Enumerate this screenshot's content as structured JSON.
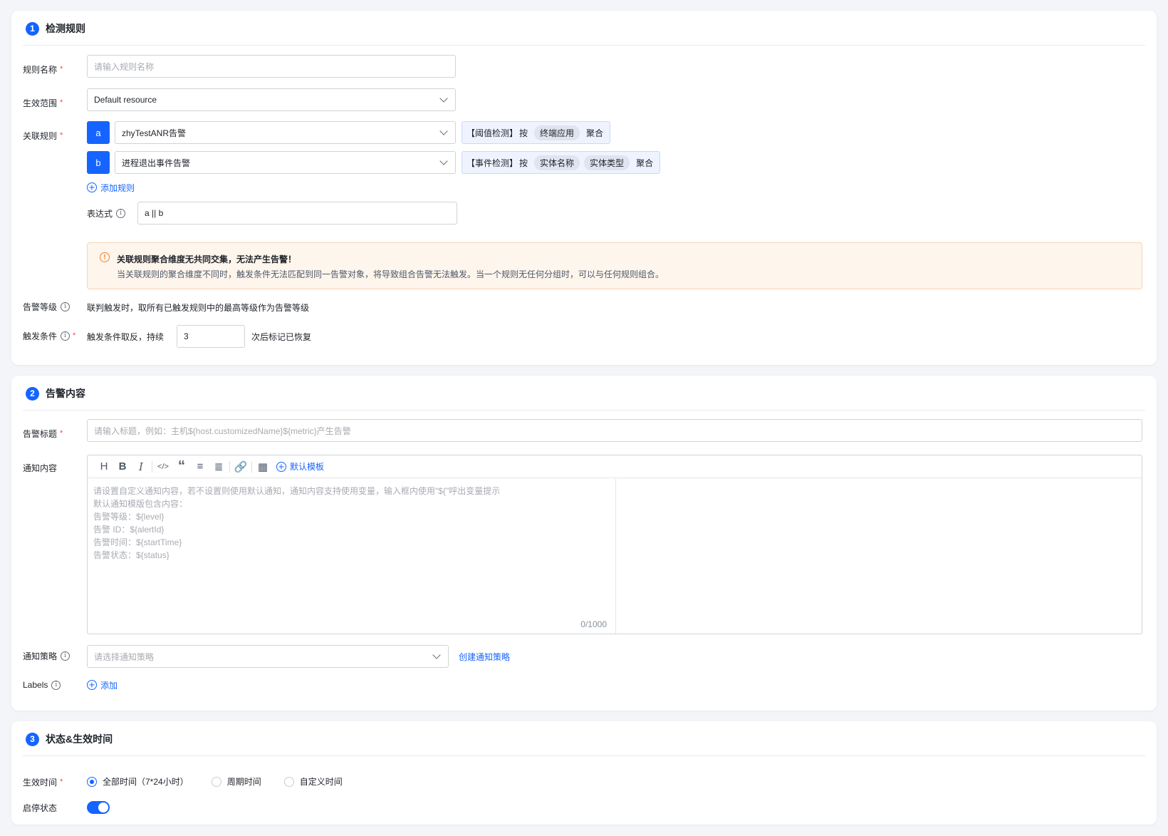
{
  "section1": {
    "num": "1",
    "title": "检测规则",
    "rule_name": {
      "label": "规则名称",
      "placeholder": "请输入规则名称"
    },
    "scope": {
      "label": "生效范围",
      "value": "Default resource"
    },
    "related": {
      "label": "关联规则",
      "rules": [
        {
          "badge": "a",
          "value": "zhyTestANR告警",
          "detect": "【阈值检测】",
          "by": "按",
          "tags": [
            "终端应用"
          ],
          "agg": "聚合"
        },
        {
          "badge": "b",
          "value": "进程退出事件告警",
          "detect": "【事件检测】",
          "by": "按",
          "tags": [
            "实体名称",
            "实体类型"
          ],
          "agg": "聚合"
        }
      ],
      "add_label": "添加规则"
    },
    "expression": {
      "label": "表达式",
      "value": "a || b"
    },
    "warning": {
      "title": "关联规则聚合维度无共同交集，无法产生告警！",
      "text": "当关联规则的聚合维度不同时，触发条件无法匹配到同一告警对象，将导致组合告警无法触发。当一个规则无任何分组时，可以与任何规则组合。"
    },
    "level": {
      "label": "告警等级",
      "text": "联判触发时，取所有已触发规则中的最高等级作为告警等级"
    },
    "trigger": {
      "label": "触发条件",
      "prefix": "触发条件取反，持续",
      "value": "3",
      "suffix": "次后标记已恢复"
    }
  },
  "section2": {
    "num": "2",
    "title": "告警内容",
    "alert_title": {
      "label": "告警标题",
      "placeholder": "请输入标题，例如：主机${host.customizedName}${metric}产生告警"
    },
    "content": {
      "label": "通知内容",
      "template_label": "默认模板",
      "lines": [
        "请设置自定义通知内容，若不设置则使用默认通知，通知内容支持使用变量，输入框内使用\"${\"呼出变量提示",
        "默认通知模版包含内容：",
        "告警等级：${level}",
        "告警 ID：${alertId}",
        "告警时间：${startTime}",
        "告警状态：${status}"
      ],
      "counter": "0/1000"
    },
    "policy": {
      "label": "通知策略",
      "placeholder": "请选择通知策略",
      "create_label": "创建通知策略"
    },
    "labels": {
      "label": "Labels",
      "add_label": "添加"
    }
  },
  "section3": {
    "num": "3",
    "title": "状态&生效时间",
    "effective": {
      "label": "生效时间",
      "options": [
        "全部时间（7*24小时）",
        "周期时间",
        "自定义时间"
      ],
      "selected": 0
    },
    "status": {
      "label": "启停状态",
      "on": true
    }
  },
  "colors": {
    "accent": "#1664ff",
    "warning_bg": "#fef5ec",
    "required": "#f54a45"
  }
}
